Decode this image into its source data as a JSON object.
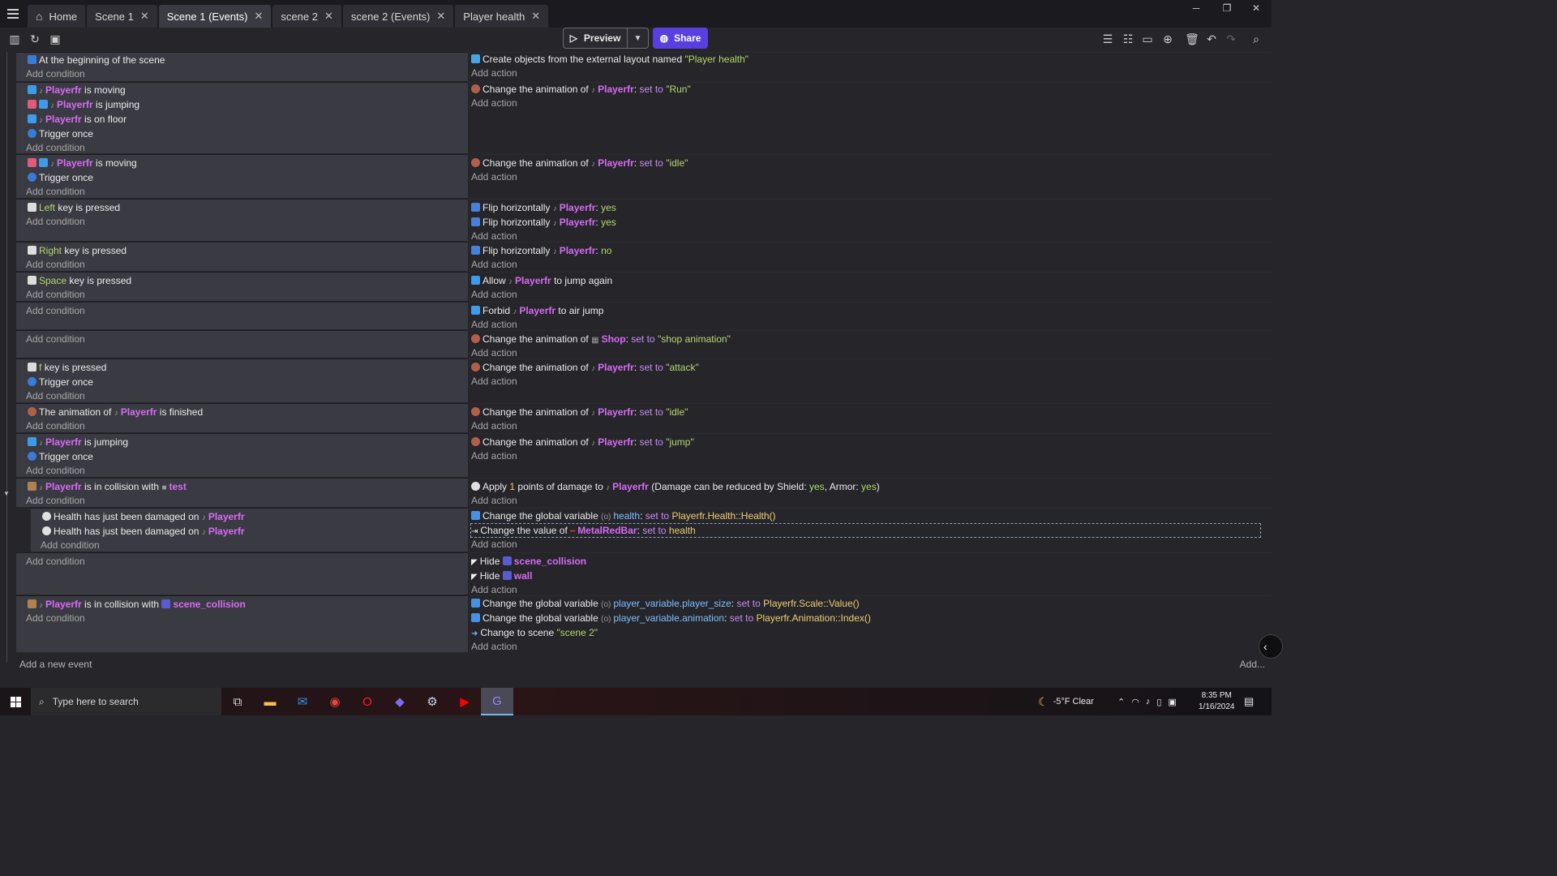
{
  "tabs": [
    {
      "label": "Home",
      "icon": "home-icon",
      "closable": false,
      "active": false
    },
    {
      "label": "Scene 1",
      "closable": true,
      "active": false
    },
    {
      "label": "Scene 1 (Events)",
      "closable": true,
      "active": true
    },
    {
      "label": "scene 2",
      "closable": true,
      "active": false
    },
    {
      "label": "scene 2 (Events)",
      "closable": true,
      "active": false
    },
    {
      "label": "Player health",
      "closable": true,
      "active": false
    }
  ],
  "toolbar": {
    "preview_label": "Preview",
    "share_label": "Share"
  },
  "texts": {
    "add_condition": "Add condition",
    "add_action": "Add action",
    "add_event": "Add a new event",
    "add_more": "Add..."
  },
  "events": [
    {
      "conditions": [
        "At the beginning of the scene"
      ],
      "actions": [
        "Create objects from the external layout named \"Player health\""
      ]
    },
    {
      "conditions": [
        "Playerfr is moving",
        "Playerfr is jumping",
        "Playerfr is on floor",
        "Trigger once"
      ],
      "actions": [
        "Change the animation of Playerfr: set to \"Run\""
      ]
    },
    {
      "conditions": [
        "Playerfr is moving",
        "Trigger once"
      ],
      "actions": [
        "Change the animation of Playerfr: set to \"idle\""
      ]
    },
    {
      "conditions": [
        "Left key is pressed"
      ],
      "actions": [
        "Flip horizontally Playerfr: yes",
        "Flip horizontally Playerfr: yes"
      ]
    },
    {
      "conditions": [
        "Right key is pressed"
      ],
      "actions": [
        "Flip horizontally Playerfr: no"
      ]
    },
    {
      "conditions": [
        "Space key is pressed"
      ],
      "actions": [
        "Allow Playerfr to jump again"
      ]
    },
    {
      "conditions": [],
      "actions": [
        "Forbid Playerfr to air jump"
      ]
    },
    {
      "conditions": [],
      "actions": [
        "Change the animation of Shop: set to \"shop animation\""
      ]
    },
    {
      "conditions": [
        "f key is pressed",
        "Trigger once"
      ],
      "actions": [
        "Change the animation of Playerfr: set to \"attack\""
      ]
    },
    {
      "conditions": [
        "The animation of Playerfr is finished"
      ],
      "actions": [
        "Change the animation of Playerfr: set to \"idle\""
      ]
    },
    {
      "conditions": [
        "Playerfr is jumping",
        "Trigger once"
      ],
      "actions": [
        "Change the animation of Playerfr: set to \"jump\""
      ]
    },
    {
      "conditions": [
        "Playerfr is in collision with test"
      ],
      "actions": [
        "Apply 1 points of damage to Playerfr (Damage can be reduced by Shield: yes, Armor: yes)"
      ]
    },
    {
      "sub_event": true,
      "conditions": [
        "Health has just been damaged on Playerfr",
        "Health has just been damaged on Playerfr"
      ],
      "actions": [
        "Change the global variable health: set to Playerfr.Health::Health()",
        "Change the value of MetalRedBar: set to health"
      ]
    },
    {
      "conditions": [],
      "actions": [
        "Hide scene_collision",
        "Hide wall"
      ]
    },
    {
      "conditions": [
        "Playerfr is in collision with scene_collision"
      ],
      "actions": [
        "Change the global variable player_variable.player_size: set to Playerfr.Scale::Value()",
        "Change the global variable player_variable.animation: set to Playerfr.Animation::Index()",
        "Change to scene \"scene 2\""
      ]
    }
  ],
  "strings": {
    "playerfr": "Playerfr",
    "shop": "Shop",
    "test": "test",
    "scene_collision": "scene_collision",
    "wall": "wall",
    "metalredbar": "MetalRedBar",
    "health": "health",
    "left": "Left",
    "right": "Right",
    "space": "Space",
    "f": "f",
    "yes": "yes",
    "no": "no",
    "one": "1",
    "run": "\"Run\"",
    "idle": "\"idle\"",
    "attack": "\"attack\"",
    "jump": "\"jump\"",
    "shop_anim": "\"shop animation\"",
    "player_health": "\"Player health\"",
    "scene2": "\"scene 2\"",
    "set_to": "set to",
    "health_expr": "Playerfr.Health::Health()",
    "size_var": "player_variable.player_size",
    "size_expr": "Playerfr.Scale::Value()",
    "anim_var": "player_variable.animation",
    "anim_expr": "Playerfr.Animation::Index()",
    "at_beginning": "At the beginning of the scene",
    "is_moving": "is moving",
    "is_jumping": "is jumping",
    "is_on_floor": "is on floor",
    "trigger_once": "Trigger once",
    "key_is_pressed": "key is pressed",
    "the_animation_of": "The animation of",
    "is_finished": "is finished",
    "is_in_collision_with": "is in collision with",
    "health_damaged": "Health has just been damaged on",
    "create_from_layout": "Create objects from the external layout named",
    "change_animation_of": "Change the animation of",
    "flip_horizontally": "Flip horizontally",
    "allow": "Allow",
    "to_jump_again": "to jump again",
    "forbid": "Forbid",
    "to_air_jump": "to air jump",
    "apply": "Apply",
    "points_of_damage_to": "points of damage to",
    "damage_reduced_by_shield": "(Damage can be reduced by Shield:",
    "armor": ", Armor:",
    "close_paren": ")",
    "change_global_variable": "Change the global variable",
    "change_value_of": "Change the value of",
    "hide": "Hide",
    "change_to_scene": "Change to scene"
  },
  "taskbar": {
    "search_placeholder": "Type here to search",
    "weather": "-5°F  Clear",
    "time": "8:35 PM",
    "date": "1/16/2024"
  },
  "colors": {
    "object_name": "#d76cf3",
    "string_value": "#b6d86f",
    "expression": "#f0d070",
    "share_button": "#5a3fe0",
    "condition_bg": "#3a3a42"
  }
}
